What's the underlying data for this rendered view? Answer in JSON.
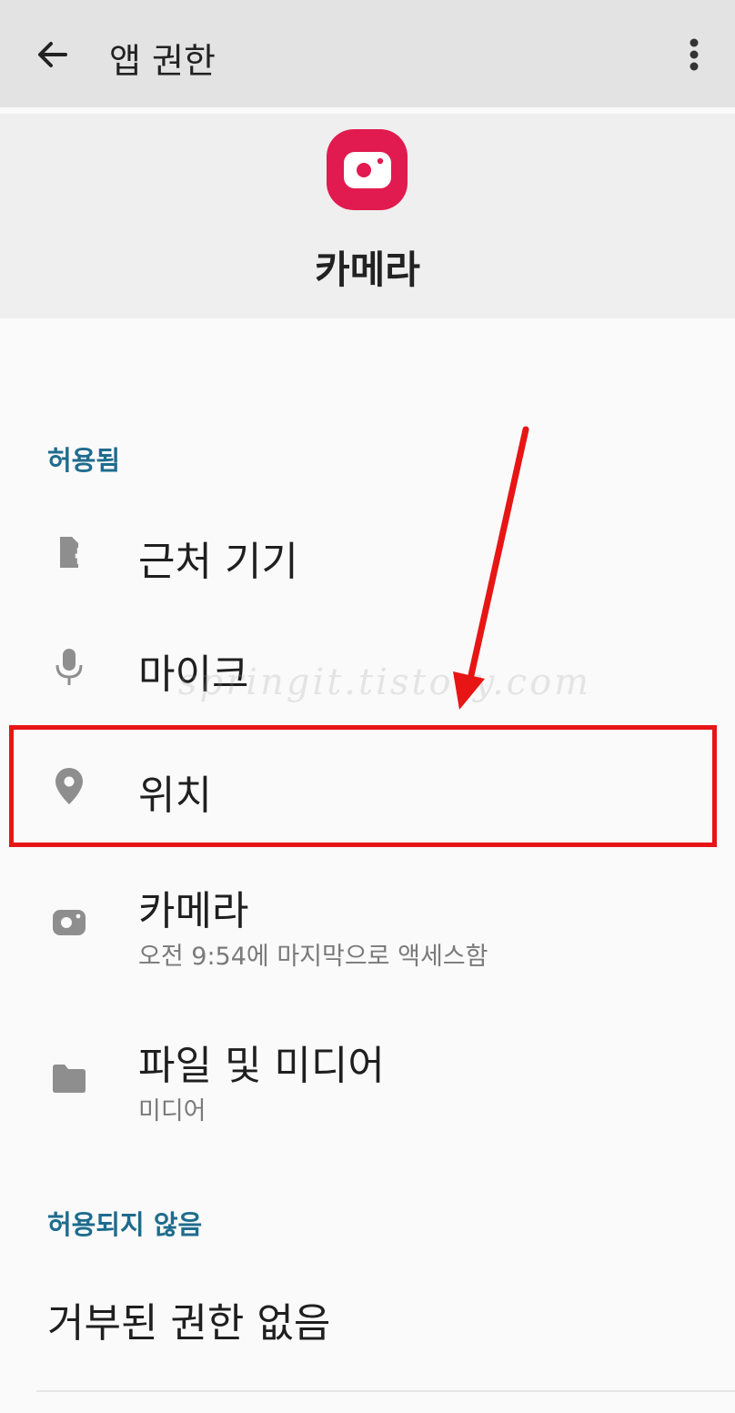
{
  "topbar": {
    "title": "앱 권한",
    "back_icon": "back-arrow-icon",
    "more_icon": "more-vert-icon"
  },
  "app": {
    "name": "카메라",
    "icon": "camera-app-icon",
    "icon_color": "#e11b4f"
  },
  "allowed": {
    "label": "허용됨",
    "items": [
      {
        "title": "근처 기기",
        "icon": "nearby-devices-icon"
      },
      {
        "title": "마이크",
        "icon": "microphone-icon"
      },
      {
        "title": "위치",
        "icon": "location-pin-icon"
      },
      {
        "title": "카메라",
        "subtitle": "오전 9:54에 마지막으로 액세스함",
        "icon": "camera-icon"
      },
      {
        "title": "파일 및 미디어",
        "subtitle": "미디어",
        "icon": "folder-icon"
      }
    ]
  },
  "denied": {
    "label": "허용되지 않음",
    "empty_text": "거부된 권한 없음"
  },
  "annotation": {
    "highlight_color": "#e81515",
    "watermark": "springit.tistory.com"
  },
  "colors": {
    "section_label": "#1e6c8e",
    "header_bg": "#efefef",
    "topbar_bg": "#e3e3e3"
  }
}
